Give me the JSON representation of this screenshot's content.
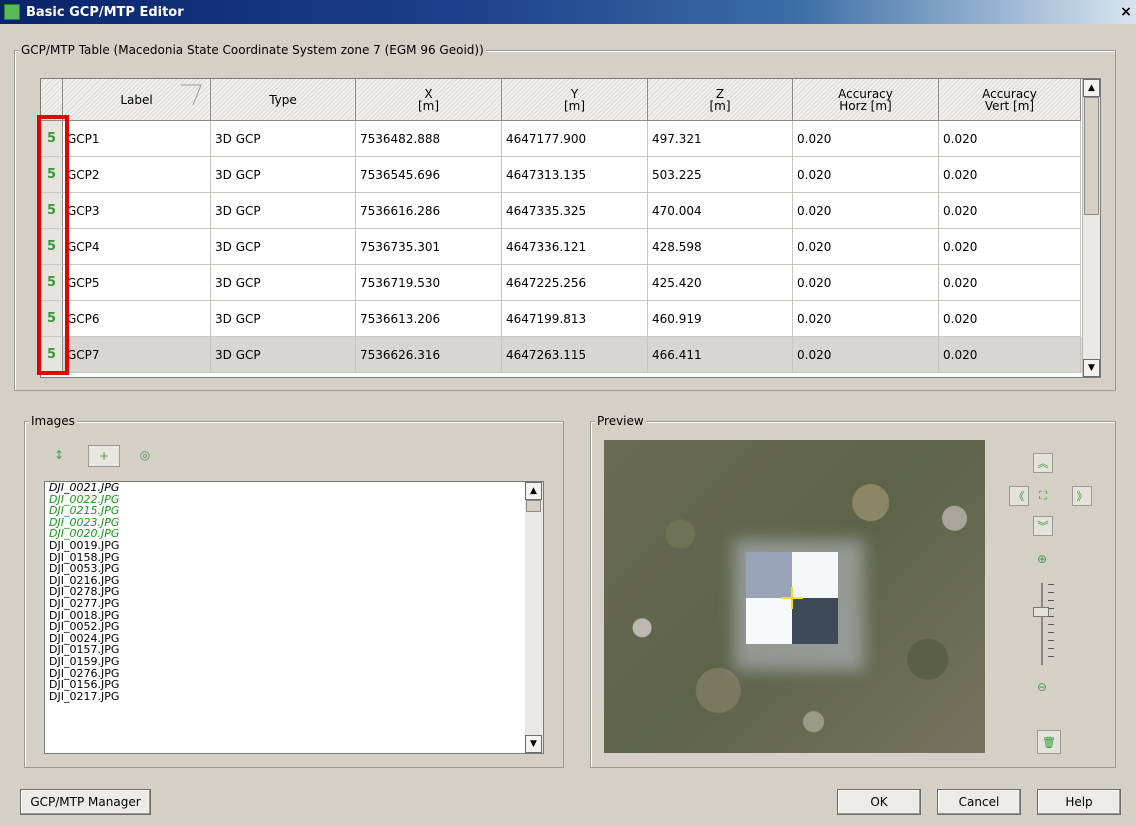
{
  "window": {
    "title": "Basic GCP/MTP Editor",
    "close_glyph": "×"
  },
  "table_group": {
    "title": "GCP/MTP Table (Macedonia State Coordinate System zone 7 (EGM 96 Geoid))",
    "columns": [
      {
        "line1": "Label",
        "line2": ""
      },
      {
        "line1": "Type",
        "line2": ""
      },
      {
        "line1": "X",
        "line2": "[m]"
      },
      {
        "line1": "Y",
        "line2": "[m]"
      },
      {
        "line1": "Z",
        "line2": "[m]"
      },
      {
        "line1": "Accuracy",
        "line2": "Horz [m]"
      },
      {
        "line1": "Accuracy",
        "line2": "Vert [m]"
      }
    ],
    "rows": [
      {
        "count": "5",
        "label": "GCP1",
        "type": "3D GCP",
        "x": "7536482.888",
        "y": "4647177.900",
        "z": "497.321",
        "acc_h": "0.020",
        "acc_v": "0.020"
      },
      {
        "count": "5",
        "label": "GCP2",
        "type": "3D GCP",
        "x": "7536545.696",
        "y": "4647313.135",
        "z": "503.225",
        "acc_h": "0.020",
        "acc_v": "0.020"
      },
      {
        "count": "5",
        "label": "GCP3",
        "type": "3D GCP",
        "x": "7536616.286",
        "y": "4647335.325",
        "z": "470.004",
        "acc_h": "0.020",
        "acc_v": "0.020"
      },
      {
        "count": "5",
        "label": "GCP4",
        "type": "3D GCP",
        "x": "7536735.301",
        "y": "4647336.121",
        "z": "428.598",
        "acc_h": "0.020",
        "acc_v": "0.020"
      },
      {
        "count": "5",
        "label": "GCP5",
        "type": "3D GCP",
        "x": "7536719.530",
        "y": "4647225.256",
        "z": "425.420",
        "acc_h": "0.020",
        "acc_v": "0.020"
      },
      {
        "count": "5",
        "label": "GCP6",
        "type": "3D GCP",
        "x": "7536613.206",
        "y": "4647199.813",
        "z": "460.919",
        "acc_h": "0.020",
        "acc_v": "0.020"
      },
      {
        "count": "5",
        "label": "GCP7",
        "type": "3D GCP",
        "x": "7536626.316",
        "y": "4647263.115",
        "z": "466.411",
        "acc_h": "0.020",
        "acc_v": "0.020"
      }
    ],
    "selected_row_index": 6,
    "scroll_up_glyph": "▲",
    "scroll_down_glyph": "▼"
  },
  "images_group": {
    "title": "Images",
    "toolbar": [
      {
        "icon": "sort-icon",
        "glyph": "↕"
      },
      {
        "icon": "marked-filter-icon",
        "glyph": "+"
      },
      {
        "icon": "camera-filter-icon",
        "glyph": "◎"
      }
    ],
    "items": [
      {
        "name": "DJI_0021.JPG",
        "state": "selected"
      },
      {
        "name": "DJI_0022.JPG",
        "state": "marked"
      },
      {
        "name": "DJI_0215.JPG",
        "state": "marked"
      },
      {
        "name": "DJI_0023.JPG",
        "state": "marked"
      },
      {
        "name": "DJI_0020.JPG",
        "state": "marked"
      },
      {
        "name": "DJI_0019.JPG",
        "state": "normal"
      },
      {
        "name": "DJI_0158.JPG",
        "state": "normal"
      },
      {
        "name": "DJI_0053.JPG",
        "state": "normal"
      },
      {
        "name": "DJI_0216.JPG",
        "state": "normal"
      },
      {
        "name": "DJI_0278.JPG",
        "state": "normal"
      },
      {
        "name": "DJI_0277.JPG",
        "state": "normal"
      },
      {
        "name": "DJI_0018.JPG",
        "state": "normal"
      },
      {
        "name": "DJI_0052.JPG",
        "state": "normal"
      },
      {
        "name": "DJI_0024.JPG",
        "state": "normal"
      },
      {
        "name": "DJI_0157.JPG",
        "state": "normal"
      },
      {
        "name": "DJI_0159.JPG",
        "state": "normal"
      },
      {
        "name": "DJI_0276.JPG",
        "state": "normal"
      },
      {
        "name": "DJI_0156.JPG",
        "state": "normal"
      },
      {
        "name": "DJI_0217.JPG",
        "state": "normal"
      }
    ],
    "marked_color": "#1a9a1a"
  },
  "preview_group": {
    "title": "Preview",
    "nav": {
      "up": "︽",
      "left": "《",
      "fit": "⛶",
      "right": "》",
      "down": "︾"
    },
    "zoom_in_glyph": "⊕",
    "zoom_out_glyph": "⊖",
    "delete_glyph": "🗑",
    "crosshair_color": "#f1e51a"
  },
  "buttons": {
    "manager": "GCP/MTP Manager",
    "ok": "OK",
    "cancel": "Cancel",
    "help": "Help"
  },
  "colors": {
    "highlight_box": "#e60000",
    "count_green": "#3a9a3a"
  }
}
